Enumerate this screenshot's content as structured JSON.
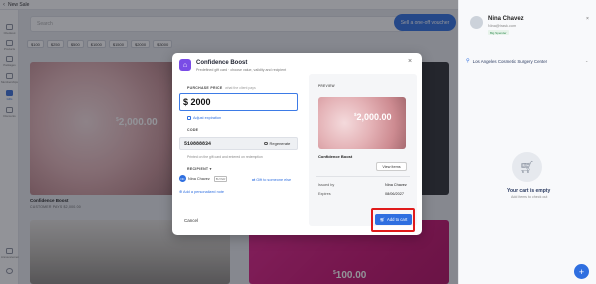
{
  "topbar": {
    "back_icon": "‹",
    "title": "New Sale"
  },
  "rail": {
    "items": [
      {
        "label": "Checkout",
        "icon": "checkout-icon"
      },
      {
        "label": "Products",
        "icon": "products-icon"
      },
      {
        "label": "Packages",
        "icon": "packages-icon"
      },
      {
        "label": "Memberships",
        "icon": "memberships-icon"
      },
      {
        "label": "Gifts",
        "icon": "gift-card-icon",
        "active": true
      },
      {
        "label": "Discounts",
        "icon": "discounts-icon"
      }
    ],
    "bottom_items": [
      {
        "label": "Announcements",
        "icon": "announcements-icon"
      },
      {
        "label": "",
        "icon": "settings-icon"
      }
    ]
  },
  "main": {
    "search_placeholder": "Search",
    "oneoff_button": "Sell a one-off voucher",
    "chips": [
      "$100",
      "$250",
      "$500",
      "$1000",
      "$1500",
      "$2000",
      "$3000"
    ],
    "card1": {
      "amount_sup": "$",
      "amount": "2,000.00",
      "title": "Confidence Boost",
      "subtitle": "CUSTOMER PAYS $2,000.00"
    },
    "card4": {
      "amount_sup": "$",
      "amount": "100.00"
    }
  },
  "modal": {
    "icon": "gift-tag-icon",
    "title": "Confidence Boost",
    "subtitle": "Predefined gift card · choose value, validity and recipient",
    "close": "×",
    "price_label": "PURCHASE PRICE",
    "price_hint": "what the client pays",
    "price_value": "$ 2000",
    "adjust_expiration": "Adjust expiration",
    "code_label": "CODE",
    "code_value": "510888834",
    "regenerate": "Regenerate",
    "code_note": "Printed on the gift card and entered on redemption",
    "recipient_label": "RECIPIENT",
    "recipient_initials": "NC",
    "recipient_name": "Nina Chavez",
    "recipient_tag": "BUYER",
    "gift_someone": "Gift to someone else",
    "personalized_note": "Add a personalized note",
    "cancel": "Cancel",
    "preview_label": "PREVIEW",
    "preview_amount_sup": "$",
    "preview_amount": "2,000.00",
    "preview_name": "Confidence Boost",
    "view_items": "View items",
    "issued_by_label": "Issued by",
    "issued_by_value": "Nina Chavez",
    "expires_label": "Expires",
    "expires_value": "08/06/2027",
    "add_to_cart": "Add to cart"
  },
  "right_panel": {
    "customer_name": "Nina Chavez",
    "customer_email": "Nina@trask.com",
    "customer_badge": "Big Spender",
    "close": "×",
    "location": "Los Angeles Cosmetic Surgery Center",
    "cart_empty_title": "Your cart is empty",
    "cart_empty_sub": "Add items to check out",
    "fab": "+"
  },
  "colors": {
    "accent": "#2f6fe0",
    "highlight": "#e01b1b",
    "modal_icon": "#7a4ce6"
  }
}
